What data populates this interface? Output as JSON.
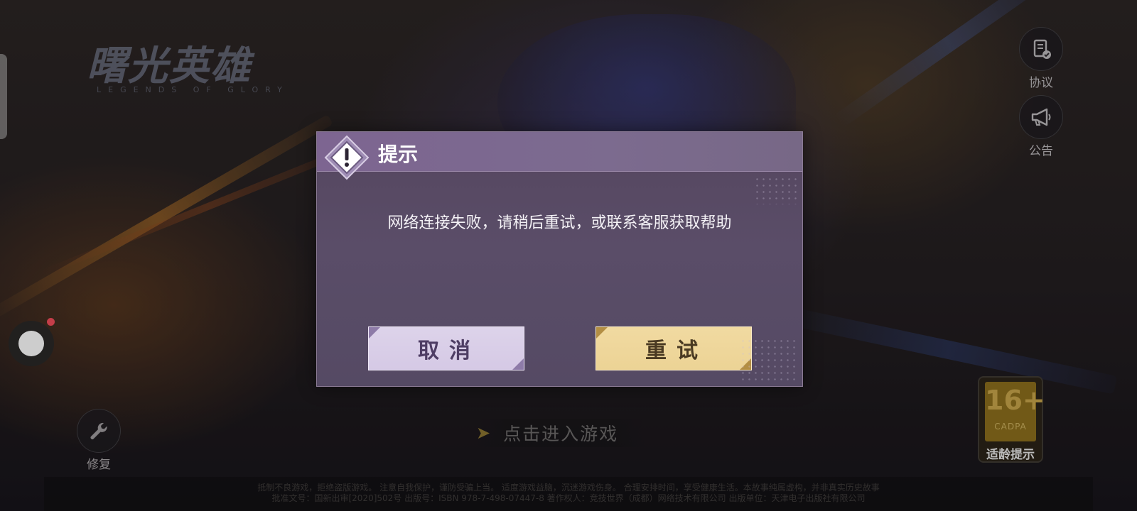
{
  "background": {
    "logo": {
      "title": "曙光英雄",
      "subtitle": "LEGENDS OF GLORY"
    },
    "enter_game": {
      "label": "点击进入游戏",
      "icon": "double-chevron-right-icon"
    },
    "side_buttons": {
      "agreement": {
        "label": "协议",
        "icon": "document-check-icon"
      },
      "notice": {
        "label": "公告",
        "icon": "megaphone-icon"
      },
      "repair": {
        "label": "修复",
        "icon": "wrench-icon"
      }
    },
    "age_rating": {
      "age": "16+",
      "org": "CADPA",
      "caption": "适龄提示"
    },
    "footer": {
      "line1": "抵制不良游戏，拒绝盗版游戏。 注意自我保护，谨防受骗上当。 适度游戏益脑，沉迷游戏伤身。 合理安排时间，享受健康生活。本故事纯属虚构，并非真实历史故事",
      "line2": "批准文号：国新出审[2020]502号  出版号：ISBN 978-7-498-07447-8  著作权人：竞技世界（成都）网络技术有限公司  出版单位：天津电子出版社有限公司"
    }
  },
  "dialog": {
    "title": "提示",
    "icon": "warning-diamond-icon",
    "message": "网络连接失败，请稍后重试，或联系客服获取帮助",
    "cancel_label": "取消",
    "retry_label": "重试"
  },
  "overlay": {
    "record_button_badge_color": "#ef4c5a"
  },
  "colors": {
    "dialog_header": "#7d6591",
    "dialog_body": "#56495f",
    "cancel_button": "#ddd3ea",
    "retry_button": "#f1daa1"
  }
}
